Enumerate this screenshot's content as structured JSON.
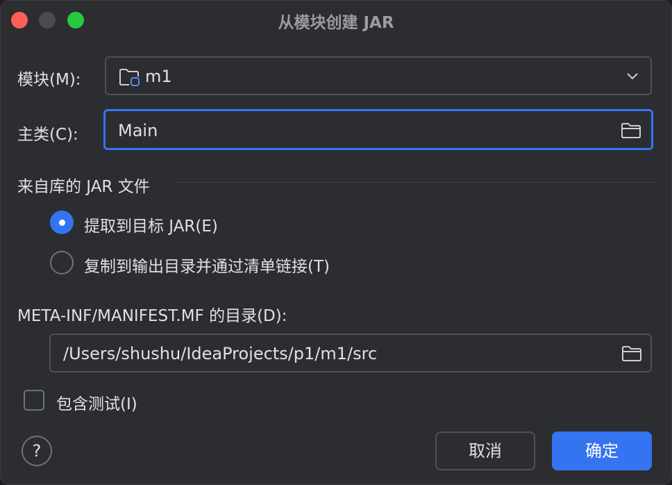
{
  "window": {
    "title": "从模块创建 JAR"
  },
  "module": {
    "label": "模块(M):",
    "value": "m1",
    "icon": "module-folder-icon"
  },
  "main_class": {
    "label": "主类(C):",
    "value": "Main",
    "icon": "folder-icon"
  },
  "jar_section": {
    "title": "来自库的 JAR 文件",
    "options": [
      {
        "label": "提取到目标 JAR(E)",
        "selected": true
      },
      {
        "label": "复制到输出目录并通过清单链接(T)",
        "selected": false
      }
    ]
  },
  "manifest": {
    "label": "META-INF/MANIFEST.MF 的目录(D):",
    "value": "/Users/shushu/IdeaProjects/p1/m1/src",
    "icon": "folder-icon"
  },
  "include_tests": {
    "label": "包含测试(I)",
    "checked": false
  },
  "buttons": {
    "help": "?",
    "cancel": "取消",
    "ok": "确定"
  },
  "colors": {
    "accent": "#3574f0",
    "background": "#2b2d30",
    "close": "#ff5f57",
    "maximize": "#28c840"
  }
}
